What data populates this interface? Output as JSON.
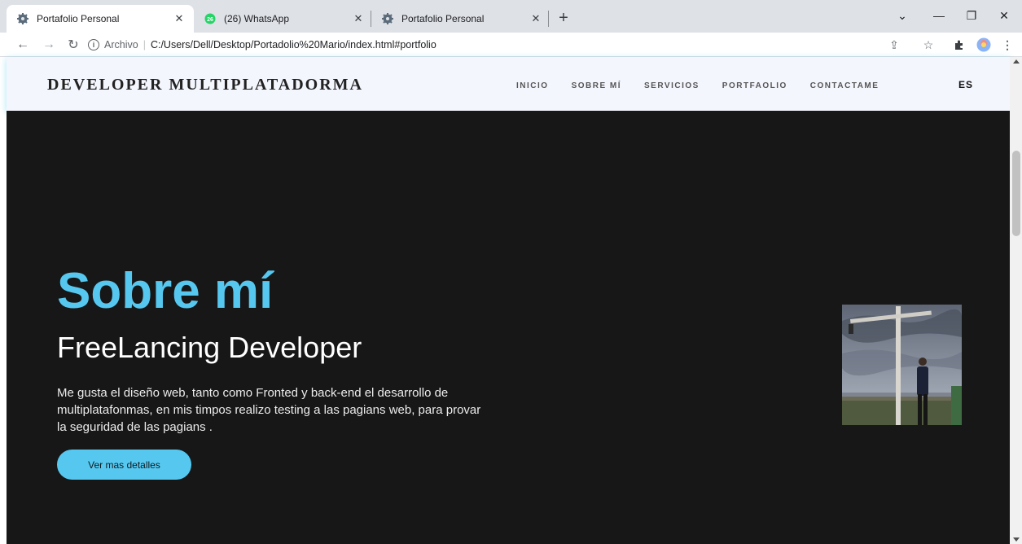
{
  "browser": {
    "tabs": [
      {
        "title": "Portafolio Personal",
        "active": true,
        "icon": "gear-favicon"
      },
      {
        "title": "(26) WhatsApp",
        "active": false,
        "icon": "whatsapp-favicon",
        "badge": "26"
      },
      {
        "title": "Portafolio Personal",
        "active": false,
        "icon": "gear-favicon"
      }
    ],
    "address": {
      "scheme_label": "Archivo",
      "url": "C:/Users/Dell/Desktop/Portadolio%20Mario/index.html#portfolio"
    }
  },
  "site": {
    "brand": "DEVELOPER MULTIPLATADORMA",
    "nav": [
      "INICIO",
      "SOBRE MÍ",
      "SERVICIOS",
      "PORTFAOLIO",
      "CONTACTAME"
    ],
    "lang": "ES"
  },
  "hero": {
    "title": "Sobre mí",
    "subtitle": "FreeLancing Developer",
    "description": "Me gusta el diseño web, tanto como Fronted y back-end el desarrollo de multiplatafonmas, en mis timpos realizo testing a las pagians web, para provar la seguridad de las pagians .",
    "button": "Ver mas detalles"
  },
  "colors": {
    "accent": "#56c8f0",
    "hero_bg": "#171717",
    "header_bg": "#f4f6fe"
  }
}
